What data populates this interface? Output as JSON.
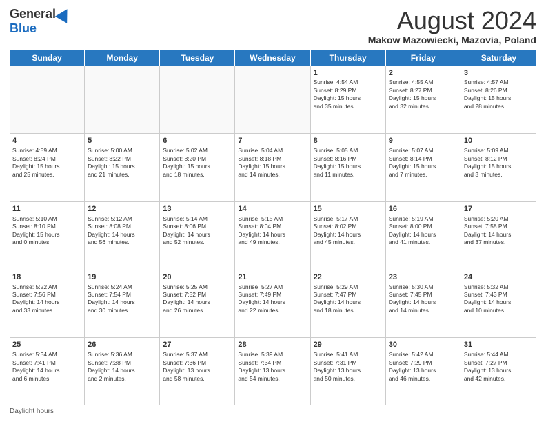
{
  "logo": {
    "general": "General",
    "blue": "Blue"
  },
  "title": "August 2024",
  "subtitle": "Makow Mazowiecki, Mazovia, Poland",
  "weekdays": [
    "Sunday",
    "Monday",
    "Tuesday",
    "Wednesday",
    "Thursday",
    "Friday",
    "Saturday"
  ],
  "footer": "Daylight hours",
  "weeks": [
    [
      {
        "day": "",
        "info": ""
      },
      {
        "day": "",
        "info": ""
      },
      {
        "day": "",
        "info": ""
      },
      {
        "day": "",
        "info": ""
      },
      {
        "day": "1",
        "info": "Sunrise: 4:54 AM\nSunset: 8:29 PM\nDaylight: 15 hours\nand 35 minutes."
      },
      {
        "day": "2",
        "info": "Sunrise: 4:55 AM\nSunset: 8:27 PM\nDaylight: 15 hours\nand 32 minutes."
      },
      {
        "day": "3",
        "info": "Sunrise: 4:57 AM\nSunset: 8:26 PM\nDaylight: 15 hours\nand 28 minutes."
      }
    ],
    [
      {
        "day": "4",
        "info": "Sunrise: 4:59 AM\nSunset: 8:24 PM\nDaylight: 15 hours\nand 25 minutes."
      },
      {
        "day": "5",
        "info": "Sunrise: 5:00 AM\nSunset: 8:22 PM\nDaylight: 15 hours\nand 21 minutes."
      },
      {
        "day": "6",
        "info": "Sunrise: 5:02 AM\nSunset: 8:20 PM\nDaylight: 15 hours\nand 18 minutes."
      },
      {
        "day": "7",
        "info": "Sunrise: 5:04 AM\nSunset: 8:18 PM\nDaylight: 15 hours\nand 14 minutes."
      },
      {
        "day": "8",
        "info": "Sunrise: 5:05 AM\nSunset: 8:16 PM\nDaylight: 15 hours\nand 11 minutes."
      },
      {
        "day": "9",
        "info": "Sunrise: 5:07 AM\nSunset: 8:14 PM\nDaylight: 15 hours\nand 7 minutes."
      },
      {
        "day": "10",
        "info": "Sunrise: 5:09 AM\nSunset: 8:12 PM\nDaylight: 15 hours\nand 3 minutes."
      }
    ],
    [
      {
        "day": "11",
        "info": "Sunrise: 5:10 AM\nSunset: 8:10 PM\nDaylight: 15 hours\nand 0 minutes."
      },
      {
        "day": "12",
        "info": "Sunrise: 5:12 AM\nSunset: 8:08 PM\nDaylight: 14 hours\nand 56 minutes."
      },
      {
        "day": "13",
        "info": "Sunrise: 5:14 AM\nSunset: 8:06 PM\nDaylight: 14 hours\nand 52 minutes."
      },
      {
        "day": "14",
        "info": "Sunrise: 5:15 AM\nSunset: 8:04 PM\nDaylight: 14 hours\nand 49 minutes."
      },
      {
        "day": "15",
        "info": "Sunrise: 5:17 AM\nSunset: 8:02 PM\nDaylight: 14 hours\nand 45 minutes."
      },
      {
        "day": "16",
        "info": "Sunrise: 5:19 AM\nSunset: 8:00 PM\nDaylight: 14 hours\nand 41 minutes."
      },
      {
        "day": "17",
        "info": "Sunrise: 5:20 AM\nSunset: 7:58 PM\nDaylight: 14 hours\nand 37 minutes."
      }
    ],
    [
      {
        "day": "18",
        "info": "Sunrise: 5:22 AM\nSunset: 7:56 PM\nDaylight: 14 hours\nand 33 minutes."
      },
      {
        "day": "19",
        "info": "Sunrise: 5:24 AM\nSunset: 7:54 PM\nDaylight: 14 hours\nand 30 minutes."
      },
      {
        "day": "20",
        "info": "Sunrise: 5:25 AM\nSunset: 7:52 PM\nDaylight: 14 hours\nand 26 minutes."
      },
      {
        "day": "21",
        "info": "Sunrise: 5:27 AM\nSunset: 7:49 PM\nDaylight: 14 hours\nand 22 minutes."
      },
      {
        "day": "22",
        "info": "Sunrise: 5:29 AM\nSunset: 7:47 PM\nDaylight: 14 hours\nand 18 minutes."
      },
      {
        "day": "23",
        "info": "Sunrise: 5:30 AM\nSunset: 7:45 PM\nDaylight: 14 hours\nand 14 minutes."
      },
      {
        "day": "24",
        "info": "Sunrise: 5:32 AM\nSunset: 7:43 PM\nDaylight: 14 hours\nand 10 minutes."
      }
    ],
    [
      {
        "day": "25",
        "info": "Sunrise: 5:34 AM\nSunset: 7:41 PM\nDaylight: 14 hours\nand 6 minutes."
      },
      {
        "day": "26",
        "info": "Sunrise: 5:36 AM\nSunset: 7:38 PM\nDaylight: 14 hours\nand 2 minutes."
      },
      {
        "day": "27",
        "info": "Sunrise: 5:37 AM\nSunset: 7:36 PM\nDaylight: 13 hours\nand 58 minutes."
      },
      {
        "day": "28",
        "info": "Sunrise: 5:39 AM\nSunset: 7:34 PM\nDaylight: 13 hours\nand 54 minutes."
      },
      {
        "day": "29",
        "info": "Sunrise: 5:41 AM\nSunset: 7:31 PM\nDaylight: 13 hours\nand 50 minutes."
      },
      {
        "day": "30",
        "info": "Sunrise: 5:42 AM\nSunset: 7:29 PM\nDaylight: 13 hours\nand 46 minutes."
      },
      {
        "day": "31",
        "info": "Sunrise: 5:44 AM\nSunset: 7:27 PM\nDaylight: 13 hours\nand 42 minutes."
      }
    ]
  ]
}
